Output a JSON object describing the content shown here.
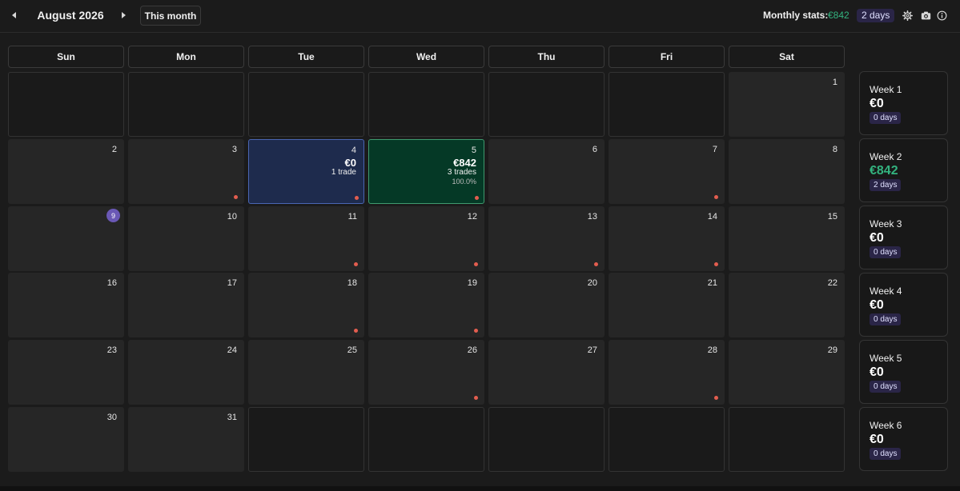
{
  "header": {
    "month_title": "August 2026",
    "this_month_label": "This month",
    "stats_label": "Monthly stats:",
    "stats_value": "€842",
    "stats_days": "2 days",
    "accent_color": "#33b37f",
    "icons": [
      "chevron-left-icon",
      "chevron-right-icon",
      "gear-icon",
      "camera-icon",
      "info-icon"
    ]
  },
  "weekdays": [
    "Sun",
    "Mon",
    "Tue",
    "Wed",
    "Thu",
    "Fri",
    "Sat"
  ],
  "weeks": [
    [
      null,
      null,
      null,
      null,
      null,
      null,
      {
        "day": "1"
      }
    ],
    [
      {
        "day": "2"
      },
      {
        "day": "3",
        "dot": true
      },
      {
        "day": "4",
        "pnl": "€0",
        "trades": "1 trade",
        "status": "loss",
        "dot": true
      },
      {
        "day": "5",
        "pnl": "€842",
        "trades": "3 trades",
        "rate": "100.0%",
        "status": "win",
        "dot": true
      },
      {
        "day": "6"
      },
      {
        "day": "7",
        "dot": true
      },
      {
        "day": "8"
      }
    ],
    [
      {
        "day": "9",
        "today": true
      },
      {
        "day": "10"
      },
      {
        "day": "11",
        "dot": true
      },
      {
        "day": "12",
        "dot": true
      },
      {
        "day": "13",
        "dot": true
      },
      {
        "day": "14",
        "dot": true
      },
      {
        "day": "15"
      }
    ],
    [
      {
        "day": "16"
      },
      {
        "day": "17"
      },
      {
        "day": "18",
        "dot": true
      },
      {
        "day": "19",
        "dot": true
      },
      {
        "day": "20"
      },
      {
        "day": "21"
      },
      {
        "day": "22"
      }
    ],
    [
      {
        "day": "23"
      },
      {
        "day": "24"
      },
      {
        "day": "25"
      },
      {
        "day": "26",
        "dot": true
      },
      {
        "day": "27"
      },
      {
        "day": "28",
        "dot": true
      },
      {
        "day": "29"
      }
    ],
    [
      {
        "day": "30"
      },
      {
        "day": "31"
      },
      null,
      null,
      null,
      null,
      null
    ]
  ],
  "week_summaries": [
    {
      "label": "Week 1",
      "pnl": "€0",
      "days": "0 days"
    },
    {
      "label": "Week 2",
      "pnl": "€842",
      "days": "2 days",
      "positive": true
    },
    {
      "label": "Week 3",
      "pnl": "€0",
      "days": "0 days"
    },
    {
      "label": "Week 4",
      "pnl": "€0",
      "days": "0 days"
    },
    {
      "label": "Week 5",
      "pnl": "€0",
      "days": "0 days"
    },
    {
      "label": "Week 6",
      "pnl": "€0",
      "days": "0 days"
    }
  ]
}
